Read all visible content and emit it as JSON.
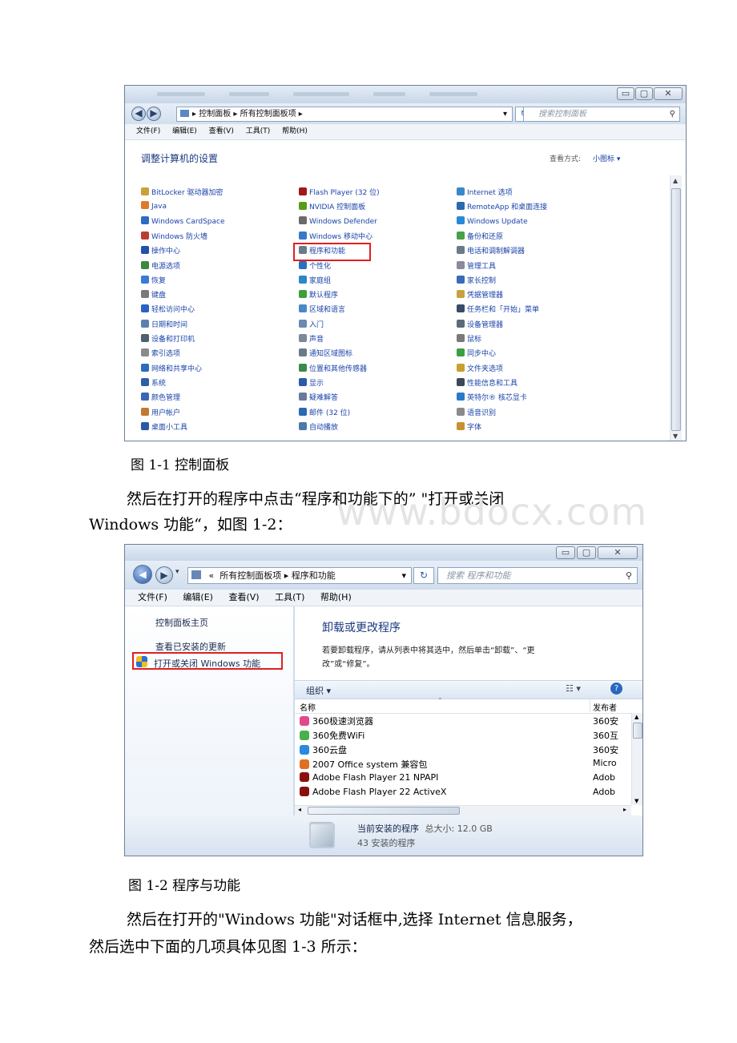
{
  "figure1": {
    "address_path": [
      "控制面板",
      "所有控制面板项"
    ],
    "search_placeholder": "搜索控制面板",
    "menu": [
      "文件(F)",
      "编辑(E)",
      "查看(V)",
      "工具(T)",
      "帮助(H)"
    ],
    "heading": "调整计算机的设置",
    "view_by_label": "查看方式:",
    "view_by_value": "小图标 ▾",
    "columns": [
      [
        "BitLocker 驱动器加密",
        "Java",
        "Windows CardSpace",
        "Windows 防火墙",
        "操作中心",
        "电源选项",
        "恢复",
        "键盘",
        "轻松访问中心",
        "日期和时间",
        "设备和打印机",
        "索引选项",
        "网络和共享中心",
        "系统",
        "颜色管理",
        "用户帐户",
        "桌面小工具"
      ],
      [
        "Flash Player (32 位)",
        "NVIDIA 控制面板",
        "Windows Defender",
        "Windows 移动中心",
        "程序和功能",
        "个性化",
        "家庭组",
        "默认程序",
        "区域和语言",
        "入门",
        "声音",
        "通知区域图标",
        "位置和其他传感器",
        "显示",
        "疑难解答",
        "邮件 (32 位)",
        "自动播放"
      ],
      [
        "Internet 选项",
        "RemoteApp 和桌面连接",
        "Windows Update",
        "备份和还原",
        "电话和调制解调器",
        "管理工具",
        "家长控制",
        "凭据管理器",
        "任务栏和「开始」菜单",
        "设备管理器",
        "鼠标",
        "同步中心",
        "文件夹选项",
        "性能信息和工具",
        "英特尔® 核芯显卡",
        "语音识别",
        "字体"
      ]
    ],
    "icon_colors": [
      [
        "#c8a23a",
        "#e07a2b",
        "#2f6bc6",
        "#b84030",
        "#2450b0",
        "#3b8a3b",
        "#3a7bd5",
        "#7a7a7a",
        "#2a62c4",
        "#5c7fb0",
        "#506070",
        "#8a8a8a",
        "#2e6ac0",
        "#2e5fa8",
        "#3a66b8",
        "#c07a30",
        "#2a5aa8"
      ],
      [
        "#a01818",
        "#5a9a1a",
        "#6a6a6a",
        "#3a78c8",
        "#6a7a8a",
        "#2a70c0",
        "#2a88c8",
        "#3aa03a",
        "#4a88c8",
        "#6a8ab0",
        "#7a8a9a",
        "#6a7a8a",
        "#3a8a4a",
        "#2a5aa8",
        "#6a7a9a",
        "#2a6ab0",
        "#4a7aa8"
      ],
      [
        "#3a88c8",
        "#2a68b0",
        "#2a88d8",
        "#4aa04a",
        "#6a7a8a",
        "#8a8a9a",
        "#3a6ab8",
        "#c8a040",
        "#3a4a6a",
        "#5a6a7a",
        "#7a7a7a",
        "#3aa040",
        "#c8a030",
        "#3a4a5a",
        "#2a7ac8",
        "#8a8a8a",
        "#c89030"
      ]
    ]
  },
  "caption1": "图 1-1 控制面板",
  "para1_line1": "然后在打开的程序中点击“程序和功能下的” \"打开或关闭",
  "para1_line2": "Windows 功能“，如图 1-2：",
  "figure2": {
    "address_prefix": "«",
    "address_path": [
      "所有控制面板项",
      "程序和功能"
    ],
    "search_placeholder": "搜索 程序和功能",
    "menu": [
      "文件(F)",
      "编辑(E)",
      "查看(V)",
      "工具(T)",
      "帮助(H)"
    ],
    "sidebar": {
      "home": "控制面板主页",
      "updates": "查看已安装的更新",
      "features": "打开或关闭 Windows 功能"
    },
    "title": "卸载或更改程序",
    "desc_line1": "若要卸载程序，请从列表中将其选中，然后单击“卸载”、“更",
    "desc_line2": "改”或“修复”。",
    "organize": "组织 ▾",
    "col_name": "名称",
    "col_publisher": "发布者",
    "programs": [
      {
        "name": "360极速浏览器",
        "publisher": "360安",
        "color": "#e04a8a"
      },
      {
        "name": "360免费WiFi",
        "publisher": "360互",
        "color": "#4ab04a"
      },
      {
        "name": "360云盘",
        "publisher": "360安",
        "color": "#2a88e0"
      },
      {
        "name": "2007 Office system 兼容包",
        "publisher": "Micro",
        "color": "#e07020"
      },
      {
        "name": "Adobe Flash Player 21 NPAPI",
        "publisher": "Adob",
        "color": "#8a1010"
      },
      {
        "name": "Adobe Flash Player 22 ActiveX",
        "publisher": "Adob",
        "color": "#8a1010"
      }
    ],
    "status_title": "当前安装的程序",
    "status_size": "总大小: 12.0 GB",
    "status_count": "43 安装的程序"
  },
  "caption2": "图 1-2 程序与功能",
  "para2_line1": "然后在打开的\"Windows 功能\"对话框中,选择 Internet 信息服务，",
  "para2_line2": "然后选中下面的几项具体见图 1-3 所示：",
  "watermark": "www.bdocx.com"
}
